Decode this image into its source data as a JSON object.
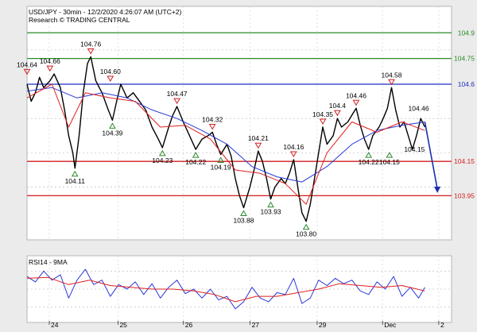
{
  "header": {
    "line1": "USD/JPY - 30min - 12/2/2020 4:26:07 AM (UTC+2)",
    "line2": "Research © TRADING CENTRAL"
  },
  "rsi_panel": {
    "label": "RSI14 - 9MA"
  },
  "colors": {
    "price": "#000000",
    "ma": "#2a3ad8",
    "ma_slow": "#e02020",
    "resistance": "#2a8a2a",
    "pivot": "#1f2fc0",
    "support": "#d21f1f",
    "up_marker": "#2a8a2a",
    "down_marker": "#d21f1f",
    "arrow": "#1a2fae"
  },
  "chart_data": [
    {
      "type": "line",
      "title": "USD/JPY - 30min - 12/2/2020 4:26:07 AM (UTC+2)",
      "x_ticks": [
        "24",
        "25",
        "26",
        "27",
        "29",
        "Dec",
        "2"
      ],
      "x_tick_positions": [
        0.0,
        0.165,
        0.322,
        0.482,
        0.643,
        0.8,
        0.935
      ],
      "ylim": [
        103.72,
        104.98
      ],
      "series": [
        {
          "kind": "price",
          "points": [
            [
              0.0,
              104.6
            ],
            [
              0.01,
              104.5
            ],
            [
              0.02,
              104.55
            ],
            [
              0.03,
              104.64
            ],
            [
              0.04,
              104.58
            ],
            [
              0.055,
              104.62
            ],
            [
              0.065,
              104.66
            ],
            [
              0.08,
              104.58
            ],
            [
              0.09,
              104.45
            ],
            [
              0.1,
              104.3
            ],
            [
              0.11,
              104.2
            ],
            [
              0.115,
              104.11
            ],
            [
              0.125,
              104.3
            ],
            [
              0.135,
              104.55
            ],
            [
              0.145,
              104.72
            ],
            [
              0.153,
              104.76
            ],
            [
              0.165,
              104.62
            ],
            [
              0.18,
              104.55
            ],
            [
              0.195,
              104.45
            ],
            [
              0.205,
              104.39
            ],
            [
              0.215,
              104.5
            ],
            [
              0.225,
              104.6
            ],
            [
              0.24,
              104.52
            ],
            [
              0.255,
              104.55
            ],
            [
              0.27,
              104.5
            ],
            [
              0.285,
              104.45
            ],
            [
              0.3,
              104.35
            ],
            [
              0.315,
              104.28
            ],
            [
              0.325,
              104.23
            ],
            [
              0.34,
              104.35
            ],
            [
              0.35,
              104.42
            ],
            [
              0.36,
              104.47
            ],
            [
              0.375,
              104.38
            ],
            [
              0.39,
              104.3
            ],
            [
              0.405,
              104.22
            ],
            [
              0.42,
              104.28
            ],
            [
              0.435,
              104.3
            ],
            [
              0.445,
              104.32
            ],
            [
              0.455,
              104.25
            ],
            [
              0.465,
              104.19
            ],
            [
              0.48,
              104.25
            ],
            [
              0.49,
              104.18
            ],
            [
              0.5,
              104.05
            ],
            [
              0.51,
              103.95
            ],
            [
              0.52,
              103.88
            ],
            [
              0.535,
              104.0
            ],
            [
              0.545,
              104.1
            ],
            [
              0.555,
              104.21
            ],
            [
              0.565,
              104.15
            ],
            [
              0.575,
              104.05
            ],
            [
              0.585,
              103.93
            ],
            [
              0.595,
              104.0
            ],
            [
              0.61,
              104.05
            ],
            [
              0.62,
              104.02
            ],
            [
              0.63,
              104.08
            ],
            [
              0.64,
              104.16
            ],
            [
              0.65,
              104.0
            ],
            [
              0.66,
              103.85
            ],
            [
              0.67,
              103.8
            ],
            [
              0.68,
              103.9
            ],
            [
              0.69,
              104.05
            ],
            [
              0.7,
              104.2
            ],
            [
              0.71,
              104.35
            ],
            [
              0.72,
              104.25
            ],
            [
              0.735,
              104.3
            ],
            [
              0.745,
              104.4
            ],
            [
              0.755,
              104.35
            ],
            [
              0.77,
              104.38
            ],
            [
              0.78,
              104.42
            ],
            [
              0.79,
              104.46
            ],
            [
              0.8,
              104.36
            ],
            [
              0.81,
              104.28
            ],
            [
              0.82,
              104.22
            ],
            [
              0.83,
              104.3
            ],
            [
              0.845,
              104.35
            ],
            [
              0.855,
              104.4
            ],
            [
              0.865,
              104.46
            ],
            [
              0.875,
              104.58
            ],
            [
              0.885,
              104.45
            ],
            [
              0.895,
              104.35
            ],
            [
              0.905,
              104.38
            ],
            [
              0.915,
              104.3
            ],
            [
              0.925,
              104.22
            ],
            [
              0.935,
              104.3
            ],
            [
              0.945,
              104.4
            ],
            [
              0.955,
              104.35
            ]
          ]
        },
        {
          "kind": "ma",
          "points": [
            [
              0.0,
              104.56
            ],
            [
              0.06,
              104.58
            ],
            [
              0.12,
              104.52
            ],
            [
              0.18,
              104.55
            ],
            [
              0.24,
              104.52
            ],
            [
              0.3,
              104.45
            ],
            [
              0.36,
              104.4
            ],
            [
              0.42,
              104.33
            ],
            [
              0.48,
              104.25
            ],
            [
              0.54,
              104.12
            ],
            [
              0.6,
              104.06
            ],
            [
              0.66,
              104.03
            ],
            [
              0.72,
              104.12
            ],
            [
              0.78,
              104.25
            ],
            [
              0.84,
              104.33
            ],
            [
              0.9,
              104.36
            ],
            [
              0.955,
              104.38
            ]
          ]
        },
        {
          "kind": "ma_slow",
          "points": [
            [
              0.0,
              104.52
            ],
            [
              0.06,
              104.6
            ],
            [
              0.1,
              104.35
            ],
            [
              0.14,
              104.55
            ],
            [
              0.2,
              104.52
            ],
            [
              0.26,
              104.5
            ],
            [
              0.32,
              104.35
            ],
            [
              0.38,
              104.36
            ],
            [
              0.44,
              104.28
            ],
            [
              0.5,
              104.1
            ],
            [
              0.56,
              104.08
            ],
            [
              0.62,
              104.02
            ],
            [
              0.67,
              103.9
            ],
            [
              0.72,
              104.2
            ],
            [
              0.78,
              104.38
            ],
            [
              0.84,
              104.32
            ],
            [
              0.9,
              104.38
            ],
            [
              0.955,
              104.33
            ]
          ]
        }
      ],
      "levels": [
        {
          "kind": "resistance",
          "label": "104.9",
          "value": 104.9
        },
        {
          "kind": "resistance",
          "label": "104.75",
          "value": 104.75
        },
        {
          "kind": "pivot",
          "label": "104.6",
          "value": 104.6
        },
        {
          "kind": "support",
          "label": "104.15",
          "value": 104.15
        },
        {
          "kind": "support",
          "label": "103.95",
          "value": 103.95
        }
      ],
      "forecast_arrow": {
        "from": [
          0.955,
          104.38
        ],
        "to": [
          0.985,
          103.97
        ]
      },
      "markers": [
        {
          "x": 0.0,
          "y": 104.64,
          "dir": "down",
          "label": "104.64"
        },
        {
          "x": 0.055,
          "y": 104.66,
          "dir": "down",
          "label": "104.66"
        },
        {
          "x": 0.153,
          "y": 104.76,
          "dir": "down",
          "label": "104.76"
        },
        {
          "x": 0.2,
          "y": 104.6,
          "dir": "down",
          "label": "104.60"
        },
        {
          "x": 0.205,
          "y": 104.39,
          "dir": "up",
          "label": "104.39"
        },
        {
          "x": 0.115,
          "y": 104.11,
          "dir": "up",
          "label": "104.11"
        },
        {
          "x": 0.325,
          "y": 104.23,
          "dir": "up",
          "label": "104.23"
        },
        {
          "x": 0.36,
          "y": 104.47,
          "dir": "down",
          "label": "104.47"
        },
        {
          "x": 0.405,
          "y": 104.22,
          "dir": "up",
          "label": "104.22"
        },
        {
          "x": 0.445,
          "y": 104.32,
          "dir": "down",
          "label": "104.32"
        },
        {
          "x": 0.465,
          "y": 104.19,
          "dir": "up",
          "label": "104.19"
        },
        {
          "x": 0.52,
          "y": 103.88,
          "dir": "up",
          "label": "103.88"
        },
        {
          "x": 0.555,
          "y": 104.21,
          "dir": "down",
          "label": "104.21"
        },
        {
          "x": 0.585,
          "y": 103.93,
          "dir": "up",
          "label": "103.93"
        },
        {
          "x": 0.64,
          "y": 104.16,
          "dir": "down",
          "label": "104.16"
        },
        {
          "x": 0.67,
          "y": 103.8,
          "dir": "up",
          "label": "103.80"
        },
        {
          "x": 0.71,
          "y": 104.35,
          "dir": "down",
          "label": "104.35"
        },
        {
          "x": 0.745,
          "y": 104.4,
          "dir": "down",
          "label": "104.4"
        },
        {
          "x": 0.79,
          "y": 104.46,
          "dir": "down",
          "label": "104.46"
        },
        {
          "x": 0.82,
          "y": 104.22,
          "dir": "up",
          "label": "104.22"
        },
        {
          "x": 0.875,
          "y": 104.58,
          "dir": "down",
          "label": "104.58"
        },
        {
          "x": 0.87,
          "y": 104.22,
          "dir": "up",
          "label": "104.15"
        },
        {
          "x": 0.94,
          "y": 104.46,
          "dir": "none",
          "label": "104.46"
        },
        {
          "x": 0.93,
          "y": 104.22,
          "dir": "none",
          "label": "104.15"
        }
      ]
    },
    {
      "type": "line",
      "title": "RSI14 - 9MA",
      "ylim": [
        20,
        80
      ],
      "series": [
        {
          "kind": "rsi",
          "points": [
            [
              0.0,
              64
            ],
            [
              0.02,
              58
            ],
            [
              0.04,
              70
            ],
            [
              0.06,
              60
            ],
            [
              0.08,
              66
            ],
            [
              0.1,
              40
            ],
            [
              0.12,
              60
            ],
            [
              0.14,
              72
            ],
            [
              0.16,
              55
            ],
            [
              0.18,
              60
            ],
            [
              0.2,
              42
            ],
            [
              0.22,
              55
            ],
            [
              0.24,
              50
            ],
            [
              0.26,
              58
            ],
            [
              0.28,
              44
            ],
            [
              0.3,
              56
            ],
            [
              0.32,
              40
            ],
            [
              0.34,
              52
            ],
            [
              0.36,
              60
            ],
            [
              0.38,
              45
            ],
            [
              0.4,
              50
            ],
            [
              0.42,
              40
            ],
            [
              0.44,
              50
            ],
            [
              0.46,
              38
            ],
            [
              0.48,
              42
            ],
            [
              0.5,
              28
            ],
            [
              0.52,
              36
            ],
            [
              0.54,
              52
            ],
            [
              0.56,
              40
            ],
            [
              0.58,
              36
            ],
            [
              0.6,
              46
            ],
            [
              0.62,
              44
            ],
            [
              0.64,
              62
            ],
            [
              0.66,
              34
            ],
            [
              0.68,
              40
            ],
            [
              0.7,
              60
            ],
            [
              0.72,
              54
            ],
            [
              0.74,
              62
            ],
            [
              0.76,
              56
            ],
            [
              0.78,
              60
            ],
            [
              0.8,
              48
            ],
            [
              0.82,
              44
            ],
            [
              0.84,
              58
            ],
            [
              0.86,
              50
            ],
            [
              0.88,
              64
            ],
            [
              0.9,
              42
            ],
            [
              0.92,
              52
            ],
            [
              0.94,
              40
            ],
            [
              0.955,
              52
            ]
          ]
        },
        {
          "kind": "rsi_ma",
          "points": [
            [
              0.0,
              62
            ],
            [
              0.05,
              63
            ],
            [
              0.1,
              55
            ],
            [
              0.15,
              60
            ],
            [
              0.2,
              54
            ],
            [
              0.25,
              52
            ],
            [
              0.3,
              50
            ],
            [
              0.35,
              50
            ],
            [
              0.4,
              48
            ],
            [
              0.45,
              44
            ],
            [
              0.5,
              36
            ],
            [
              0.55,
              42
            ],
            [
              0.6,
              42
            ],
            [
              0.65,
              46
            ],
            [
              0.7,
              50
            ],
            [
              0.75,
              56
            ],
            [
              0.8,
              54
            ],
            [
              0.85,
              52
            ],
            [
              0.9,
              54
            ],
            [
              0.955,
              48
            ]
          ]
        }
      ]
    }
  ]
}
